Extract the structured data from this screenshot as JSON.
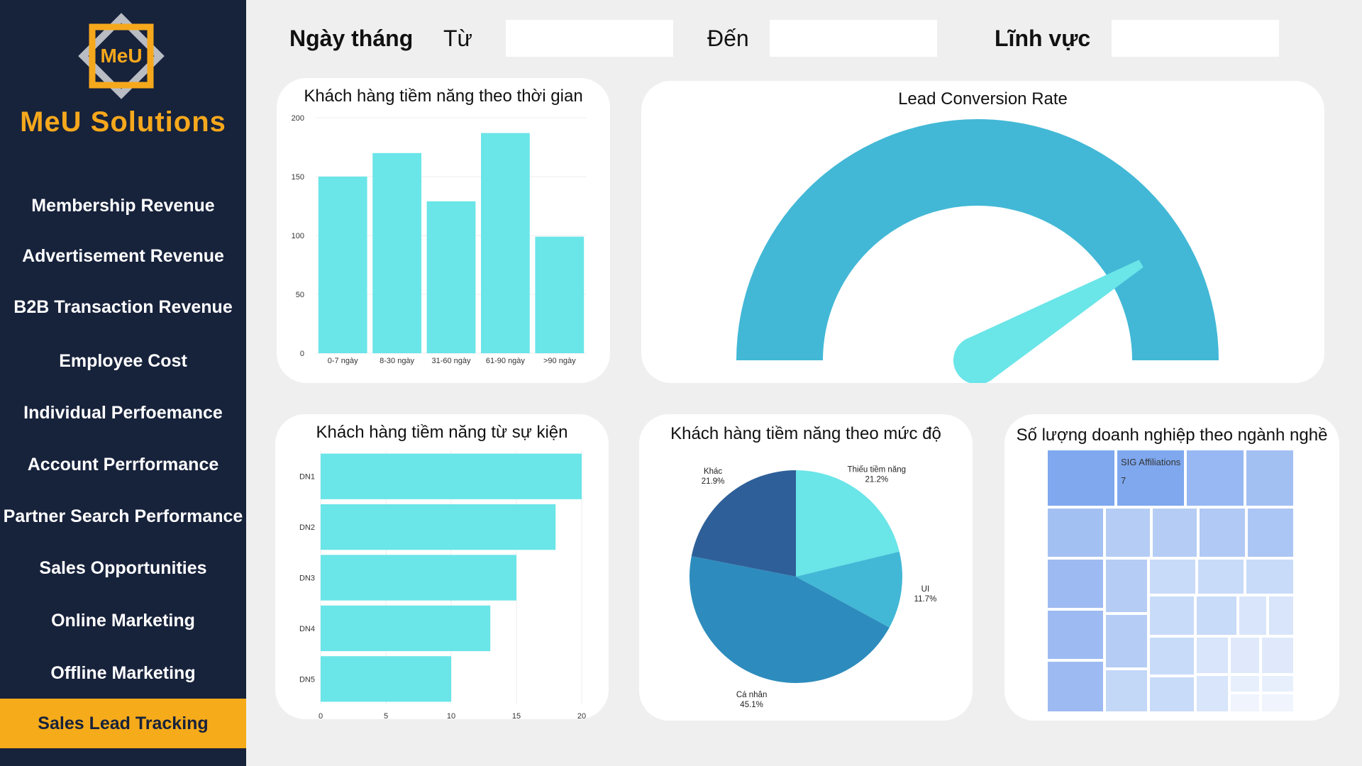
{
  "brand": {
    "logo_text": "MeU",
    "name": "MeU Solutions"
  },
  "nav": [
    {
      "label": "Membership Revenue",
      "active": false
    },
    {
      "label": "Advertisement Revenue",
      "active": false
    },
    {
      "label": "B2B Transaction Revenue",
      "active": false
    },
    {
      "label": "Employee Cost",
      "active": false
    },
    {
      "label": "Individual Perfoemance",
      "active": false
    },
    {
      "label": "Account Perrformance",
      "active": false
    },
    {
      "label": "Partner Search Performance",
      "active": false
    },
    {
      "label": "Sales Opportunities",
      "active": false
    },
    {
      "label": "Online Marketing",
      "active": false
    },
    {
      "label": "Offline Marketing",
      "active": false
    },
    {
      "label": "Sales Lead Tracking",
      "active": true
    }
  ],
  "filters": {
    "date_label": "Ngày tháng",
    "from_label": "Từ",
    "from_value": "",
    "to_label": "Đến",
    "to_value": "",
    "field_label": "Lĩnh vực",
    "field_value": ""
  },
  "colors": {
    "sidebar": "#17223b",
    "accent": "#f6ab1a",
    "bar": "#6ae5e8",
    "gauge": "#42b8d6",
    "pie_dark": "#2e5f98",
    "pie_mid": "#2d8cbd"
  },
  "chart_data": [
    {
      "type": "bar",
      "title": "Khách hàng tiềm năng theo thời gian",
      "categories": [
        "0-7 ngày",
        "8-30 ngày",
        "31-60 ngày",
        "61-90 ngày",
        ">90 ngày"
      ],
      "values": [
        150,
        170,
        129,
        187,
        99
      ],
      "ylim": [
        0,
        200
      ],
      "yticks": [
        0,
        50,
        100,
        150,
        200
      ],
      "grid": true
    },
    {
      "type": "gauge",
      "title": "Lead Conversion Rate",
      "value": 0.83,
      "range": [
        0,
        1
      ]
    },
    {
      "type": "bar",
      "orientation": "horizontal",
      "title": "Khách hàng tiềm năng từ sự kiện",
      "categories": [
        "DN1",
        "DN2",
        "DN3",
        "DN4",
        "DN5"
      ],
      "values": [
        20,
        18,
        15,
        13,
        10
      ],
      "xlim": [
        0,
        20
      ],
      "xticks": [
        0,
        5,
        10,
        15,
        20
      ],
      "grid": true
    },
    {
      "type": "pie",
      "title": "Khách hàng tiềm năng theo mức độ",
      "slices": [
        {
          "label": "Thiếu tiềm năng",
          "pct_label": "21.2%",
          "value": 21.2,
          "color": "#6ae5e8"
        },
        {
          "label": "UI",
          "pct_label": "11.7%",
          "value": 11.7,
          "color": "#42b8d6"
        },
        {
          "label": "Cá nhân",
          "pct_label": "45.1%",
          "value": 45.1,
          "color": "#2d8cbd"
        },
        {
          "label": "Khác",
          "pct_label": "21.9%",
          "value": 21.9,
          "color": "#2e5f98"
        }
      ]
    },
    {
      "type": "treemap",
      "title": "Số lượng doanh nghiệp theo ngành nghề",
      "highlight": {
        "label": "SIG Affiliations",
        "value": "7"
      }
    }
  ]
}
